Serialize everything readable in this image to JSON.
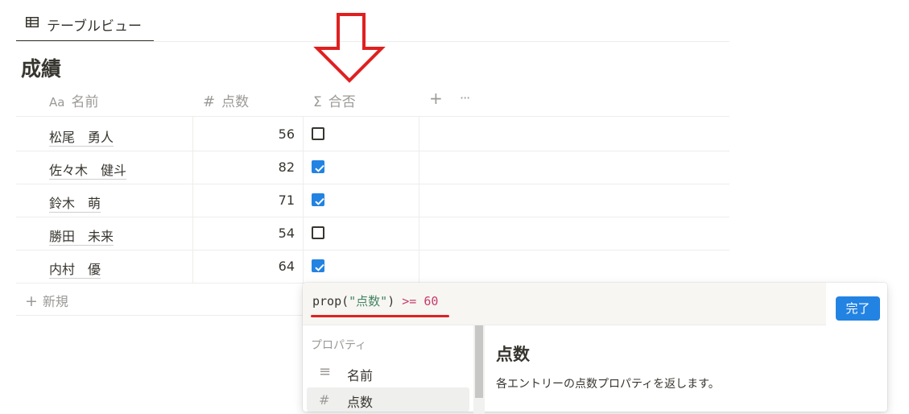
{
  "view": {
    "tab_label": "テーブルビュー",
    "tab_icon": "table-icon"
  },
  "database": {
    "title": "成績"
  },
  "columns": [
    {
      "icon_text": "Aa",
      "label": "名前",
      "icon": "text-type-icon"
    },
    {
      "icon_text": "#",
      "label": "点数",
      "icon": "number-type-icon"
    },
    {
      "icon_text": "Σ",
      "label": "合否",
      "icon": "formula-type-icon"
    }
  ],
  "header_actions": {
    "add": "+",
    "more": "···"
  },
  "rows": [
    {
      "name": "松尾　勇人",
      "score": "56",
      "pass": false
    },
    {
      "name": "佐々木　健斗",
      "score": "82",
      "pass": true
    },
    {
      "name": "鈴木　萌",
      "score": "71",
      "pass": true
    },
    {
      "name": "勝田　未来",
      "score": "54",
      "pass": false
    },
    {
      "name": "内村　優",
      "score": "64",
      "pass": true
    }
  ],
  "new_row": {
    "plus": "+",
    "label": "新規"
  },
  "formula": {
    "fn": "prop(",
    "arg": "\"点数\"",
    "close": ")",
    "op": ">=",
    "num": "60",
    "done_label": "完了",
    "section_label": "プロパティ",
    "properties": [
      {
        "icon_text": "≡",
        "label": "名前",
        "icon": "text-lines-icon"
      },
      {
        "icon_text": "#",
        "label": "点数",
        "icon": "number-icon"
      }
    ],
    "detail_title": "点数",
    "detail_desc": "各エントリーの点数プロパティを返します。"
  },
  "colors": {
    "accent": "#2383e2",
    "annotation_red": "#e02020",
    "string_green": "#448361",
    "operator_pink": "#c73c6c"
  }
}
